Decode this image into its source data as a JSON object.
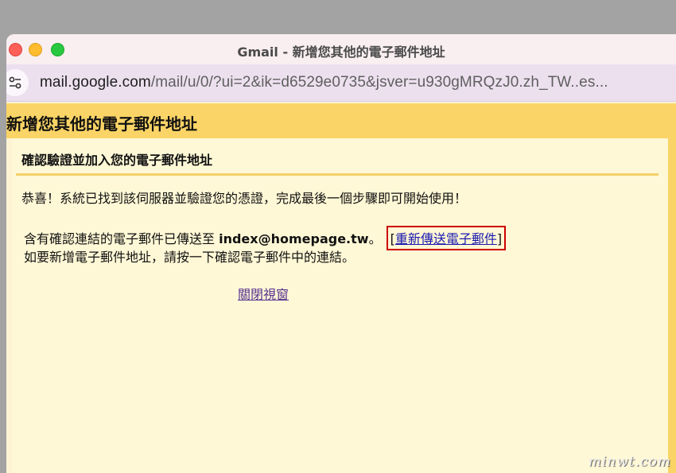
{
  "window": {
    "title": "Gmail - 新增您其他的電子郵件地址"
  },
  "address_bar": {
    "host": "mail.google.com",
    "path": "/mail/u/0/?ui=2&ik=d6529e0735&jsver=u930gMRQzJ0.zh_TW..es..."
  },
  "page": {
    "header_title": "新增您其他的電子郵件地址",
    "section_title": "確認驗證並加入您的電子郵件地址",
    "congrats_text": "恭喜！系統已找到該伺服器並驗證您的憑證，完成最後一個步驟即可開始使用！",
    "sent_prefix": "含有確認連結的電子郵件已傳送至 ",
    "sent_email": "index@homepage.tw",
    "sent_suffix": "。",
    "resend_bracket_open": "[",
    "resend_link": "重新傳送電子郵件",
    "resend_bracket_close": "]",
    "instruction_text": "如要新增電子郵件地址，請按一下確認電子郵件中的連結。",
    "close_link": "關閉視窗"
  },
  "watermark": "minwt.com",
  "colors": {
    "header_bg": "#fad466",
    "content_bg": "#fff8d6",
    "highlight_border": "#cc0000",
    "link": "#1a1ab0"
  }
}
